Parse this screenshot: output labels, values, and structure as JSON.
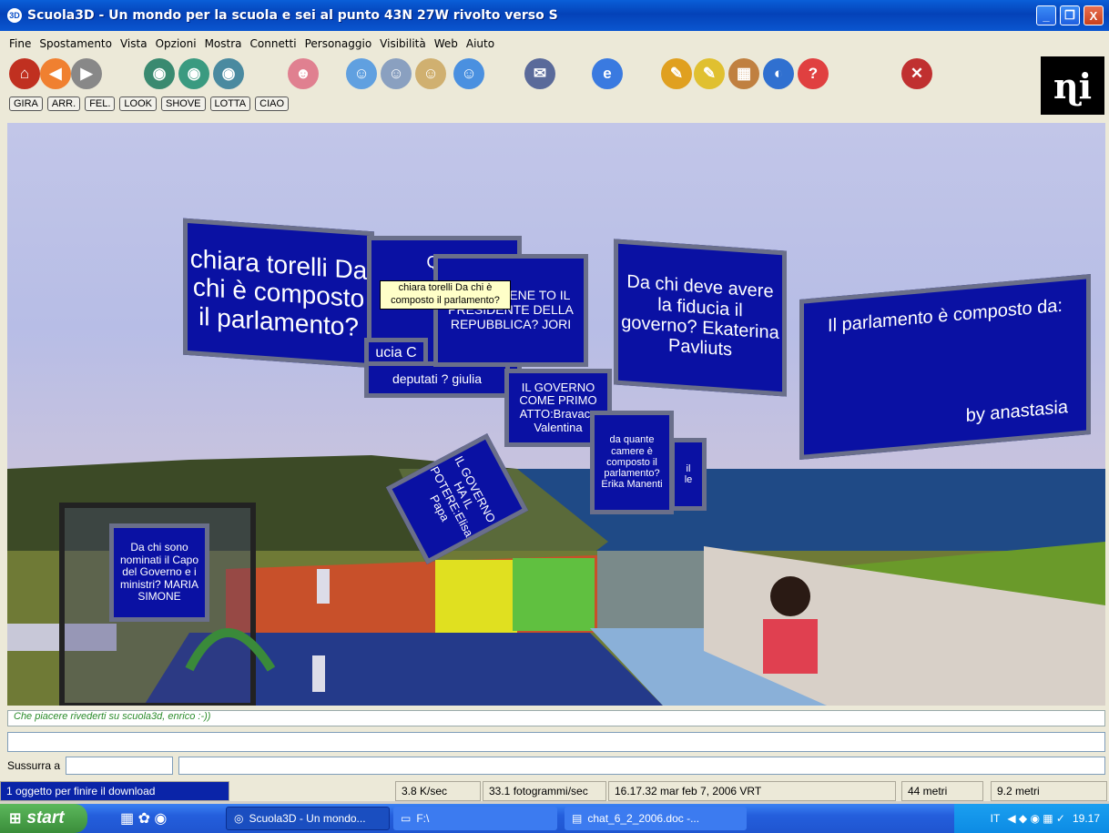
{
  "window": {
    "title": "Scuola3D - Un mondo per la scuola e sei al punto 43N 27W rivolto verso S",
    "minimize": "_",
    "maximize": "❐",
    "close": "X"
  },
  "menu": [
    "Fine",
    "Spostamento",
    "Vista",
    "Opzioni",
    "Mostra",
    "Connetti",
    "Personaggio",
    "Visibilità",
    "Web",
    "Aiuto"
  ],
  "toolbar_icons": [
    {
      "name": "home-icon",
      "glyph": "⌂",
      "color": "#c03020"
    },
    {
      "name": "back-icon",
      "glyph": "◀",
      "color": "#f08030"
    },
    {
      "name": "forward-icon",
      "glyph": "▶",
      "color": "#888888"
    },
    {
      "name": "view-first-icon",
      "glyph": "◉",
      "color": "#3a8a70"
    },
    {
      "name": "view-third-icon",
      "glyph": "◉",
      "color": "#3a9a80"
    },
    {
      "name": "view-front-icon",
      "glyph": "◉",
      "color": "#4a8aa0"
    },
    {
      "name": "avatar-dance-icon",
      "glyph": "☻",
      "color": "#e08090"
    },
    {
      "name": "fly-icon",
      "glyph": "☺",
      "color": "#60a0e0"
    },
    {
      "name": "teleport-icon",
      "glyph": "☺",
      "color": "#8aa0c0"
    },
    {
      "name": "person-icon",
      "glyph": "☺",
      "color": "#d0b070"
    },
    {
      "name": "users-icon",
      "glyph": "☺",
      "color": "#4a90e0"
    },
    {
      "name": "chat-icon",
      "glyph": "✉",
      "color": "#5a6a9a"
    },
    {
      "name": "web-icon",
      "glyph": "e",
      "color": "#3a7ae0"
    },
    {
      "name": "build-icon",
      "glyph": "✎",
      "color": "#e0a020"
    },
    {
      "name": "edit-icon",
      "glyph": "✎",
      "color": "#e0c030"
    },
    {
      "name": "map-icon",
      "glyph": "▦",
      "color": "#c08040"
    },
    {
      "name": "world-icon",
      "glyph": "◐",
      "color": "#3070d0"
    },
    {
      "name": "help-icon",
      "glyph": "?",
      "color": "#e04040"
    },
    {
      "name": "stop-icon",
      "glyph": "✕",
      "color": "#c03030"
    }
  ],
  "logo": "ɳi",
  "gestures": [
    "GIRA",
    "ARR.",
    "FEL.",
    "LOOK",
    "SHOVE",
    "LOTTA",
    "CIAO"
  ],
  "panels": [
    "chiara torelli Da chi è composto il parlamento?",
    "QUA",
    "ucia C",
    "deputati ? giulia",
    "DA CHI VIENE TO IL PRESIDENTE DELLA REPUBBLICA? JORI",
    "Da chi deve avere la fiducia il governo? Ekaterina Pavliuts",
    "Il parlamento è composto da:",
    "by anastasia",
    "IL GOVERNO COME PRIMO ATTO:Bravaco Valentina",
    "da quante camere è composto il parlamento?Erika Manenti",
    "IL GOVERNO HA IL POTERE:Elisa Papa",
    "Da chi sono nominati il Capo del Governo e i ministri? MARIA SIMONE",
    "il",
    "le"
  ],
  "tooltip": "chiara torelli Da chi è composto il parlamento?",
  "chat_message": "Che piacere rivederti su scuola3d, enrico :-))",
  "whisper_label": "Sussurra a",
  "status": {
    "download": "1 oggetto per finire il download",
    "speed": "3.8 K/sec",
    "fps": "33.1 fotogrammi/sec",
    "datetime": "16.17.32 mar feb 7, 2006 VRT",
    "distance1": "44 metri",
    "distance2": "9.2 metri"
  },
  "taskbar": {
    "start": "start",
    "tasks": [
      "Scuola3D - Un mondo...",
      "F:\\",
      "chat_6_2_2006.doc -..."
    ],
    "lang": "IT",
    "clock": "19.17"
  },
  "colors": {
    "panel_blue": "#0a11a3",
    "titlebar": "#0a56d0",
    "chat_green": "#2b8c2b"
  }
}
